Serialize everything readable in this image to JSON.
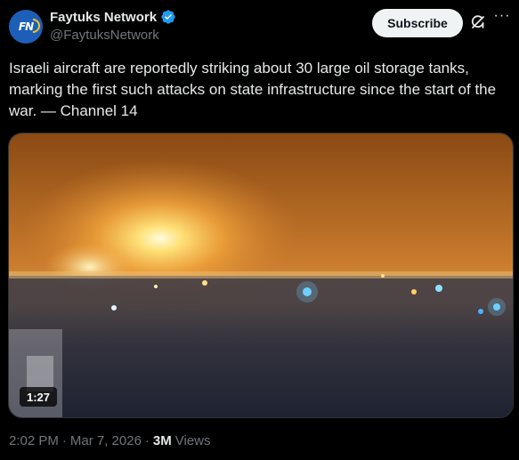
{
  "author": {
    "display_name": "Faytuks Network",
    "handle": "@FaytuksNetwork",
    "avatar_label": "FN",
    "verified_icon": "verified-badge-icon",
    "verified_color": "#1d9bf0"
  },
  "actions": {
    "subscribe_label": "Subscribe",
    "grok_icon": "grok-icon",
    "more_icon": "more-icon",
    "more_glyph": "···"
  },
  "tweet": {
    "text": "Israeli aircraft are reportedly striking about 30 large oil storage tanks, marking the first such attacks on state infrastructure since the start of the war. — Channel 14"
  },
  "media": {
    "type": "video",
    "duration": "1:27"
  },
  "meta": {
    "time": "2:02 PM",
    "date": "Mar 7, 2026",
    "separator": "·",
    "views_count": "3M",
    "views_label": "Views"
  }
}
